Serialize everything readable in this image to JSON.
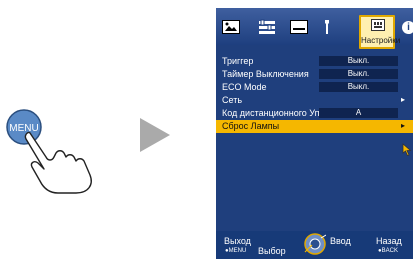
{
  "illustration": {
    "button_label": "MENU",
    "button_color": "#5a8ac6"
  },
  "osd": {
    "tabs": [
      {
        "icon": "picture-icon"
      },
      {
        "icon": "adjust-icon"
      },
      {
        "icon": "display-icon"
      },
      {
        "icon": "install-icon"
      }
    ],
    "active_tab": {
      "icon": "settings-icon",
      "label": "Настройки"
    },
    "info_icon": "i",
    "menu_items": [
      {
        "label": "Триггер",
        "value": "Выкл.",
        "has_arrow": false,
        "selected": false
      },
      {
        "label": "Таймер Выключения",
        "value": "Выкл.",
        "has_arrow": false,
        "selected": false
      },
      {
        "label": "ECO Mode",
        "value": "Выкл.",
        "has_arrow": false,
        "selected": false
      },
      {
        "label": "Сеть",
        "value": "",
        "has_arrow": true,
        "selected": false
      },
      {
        "label": "Код дистанционного Упр.",
        "value": "A",
        "has_arrow": false,
        "selected": false
      },
      {
        "label": "Сброс Лампы",
        "value": "",
        "has_arrow": true,
        "selected": true
      }
    ],
    "bottom": {
      "exit_label": "Выход",
      "exit_sub": "●MENU",
      "select_label": "Выбор",
      "enter_label": "Ввод",
      "back_label": "Назад",
      "back_sub": "●BACK"
    },
    "colors": {
      "panel": "#1f3f7d",
      "highlight": "#f5b700",
      "value_box": "#0f2450"
    }
  }
}
